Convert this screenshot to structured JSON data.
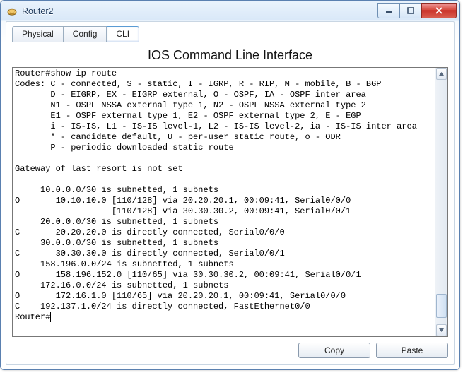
{
  "window": {
    "title": "Router2"
  },
  "tabs": [
    {
      "label": "Physical",
      "active": false
    },
    {
      "label": "Config",
      "active": false
    },
    {
      "label": "CLI",
      "active": true
    }
  ],
  "pane_title": "IOS Command Line Interface",
  "terminal_lines": [
    "Router#show ip route",
    "Codes: C - connected, S - static, I - IGRP, R - RIP, M - mobile, B - BGP",
    "       D - EIGRP, EX - EIGRP external, O - OSPF, IA - OSPF inter area",
    "       N1 - OSPF NSSA external type 1, N2 - OSPF NSSA external type 2",
    "       E1 - OSPF external type 1, E2 - OSPF external type 2, E - EGP",
    "       i - IS-IS, L1 - IS-IS level-1, L2 - IS-IS level-2, ia - IS-IS inter area",
    "       * - candidate default, U - per-user static route, o - ODR",
    "       P - periodic downloaded static route",
    "",
    "Gateway of last resort is not set",
    "",
    "     10.0.0.0/30 is subnetted, 1 subnets",
    "O       10.10.10.0 [110/128] via 20.20.20.1, 00:09:41, Serial0/0/0",
    "                   [110/128] via 30.30.30.2, 00:09:41, Serial0/0/1",
    "     20.0.0.0/30 is subnetted, 1 subnets",
    "C       20.20.20.0 is directly connected, Serial0/0/0",
    "     30.0.0.0/30 is subnetted, 1 subnets",
    "C       30.30.30.0 is directly connected, Serial0/0/1",
    "     158.196.0.0/24 is subnetted, 1 subnets",
    "O       158.196.152.0 [110/65] via 30.30.30.2, 00:09:41, Serial0/0/1",
    "     172.16.0.0/24 is subnetted, 1 subnets",
    "O       172.16.1.0 [110/65] via 20.20.20.1, 00:09:41, Serial0/0/0",
    "C    192.137.1.0/24 is directly connected, FastEthernet0/0"
  ],
  "prompt": "Router#",
  "buttons": {
    "copy": "Copy",
    "paste": "Paste"
  }
}
